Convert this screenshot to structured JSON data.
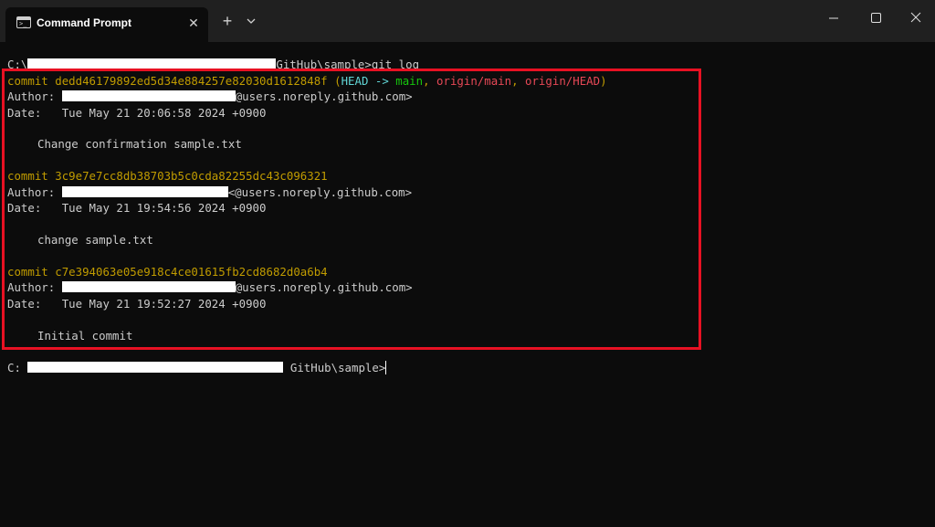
{
  "window": {
    "tab_title": "Command Prompt",
    "tab_close": "✕",
    "new_tab": "+"
  },
  "terminal": {
    "prompt_line": {
      "drive": "C:\\",
      "path_suffix": "GitHub\\sample>",
      "command": "git log"
    },
    "commits": [
      {
        "label": "commit",
        "hash": "dedd46179892ed5d34e884257e82030d1612848f",
        "refs": {
          "open": "(",
          "head": "HEAD",
          "arrow": " -> ",
          "branch": "main",
          "sep1": ", ",
          "origin_main": "origin/main",
          "sep2": ", ",
          "origin_head": "origin/HEAD",
          "close": ")"
        },
        "author_label": "Author: ",
        "author_email_suffix": "@users.noreply.github.com>",
        "date_label": "Date:   ",
        "date": "Tue May 21 20:06:58 2024 +0900",
        "message": "Change confirmation sample.txt"
      },
      {
        "label": "commit",
        "hash": "3c9e7e7cc8db38703b5c0cda82255dc43c096321",
        "author_label": "Author: ",
        "author_email_suffix": "<@users.noreply.github.com>",
        "date_label": "Date:   ",
        "date": "Tue May 21 19:54:56 2024 +0900",
        "message": "change sample.txt"
      },
      {
        "label": "commit",
        "hash": "c7e394063e05e918c4ce01615fb2cd8682d0a6b4",
        "author_label": "Author: ",
        "author_email_suffix": "@users.noreply.github.com>",
        "date_label": "Date:   ",
        "date": "Tue May 21 19:52:27 2024 +0900",
        "message": "Initial commit"
      }
    ],
    "final_prompt": {
      "drive": "C:",
      "path_suffix": "GitHub\\sample>"
    }
  },
  "colors": {
    "commit_yellow": "#c19c00",
    "head_cyan": "#61d6d6",
    "branch_green": "#16c60c",
    "origin_red": "#e74856",
    "highlight_red": "#e81123"
  }
}
